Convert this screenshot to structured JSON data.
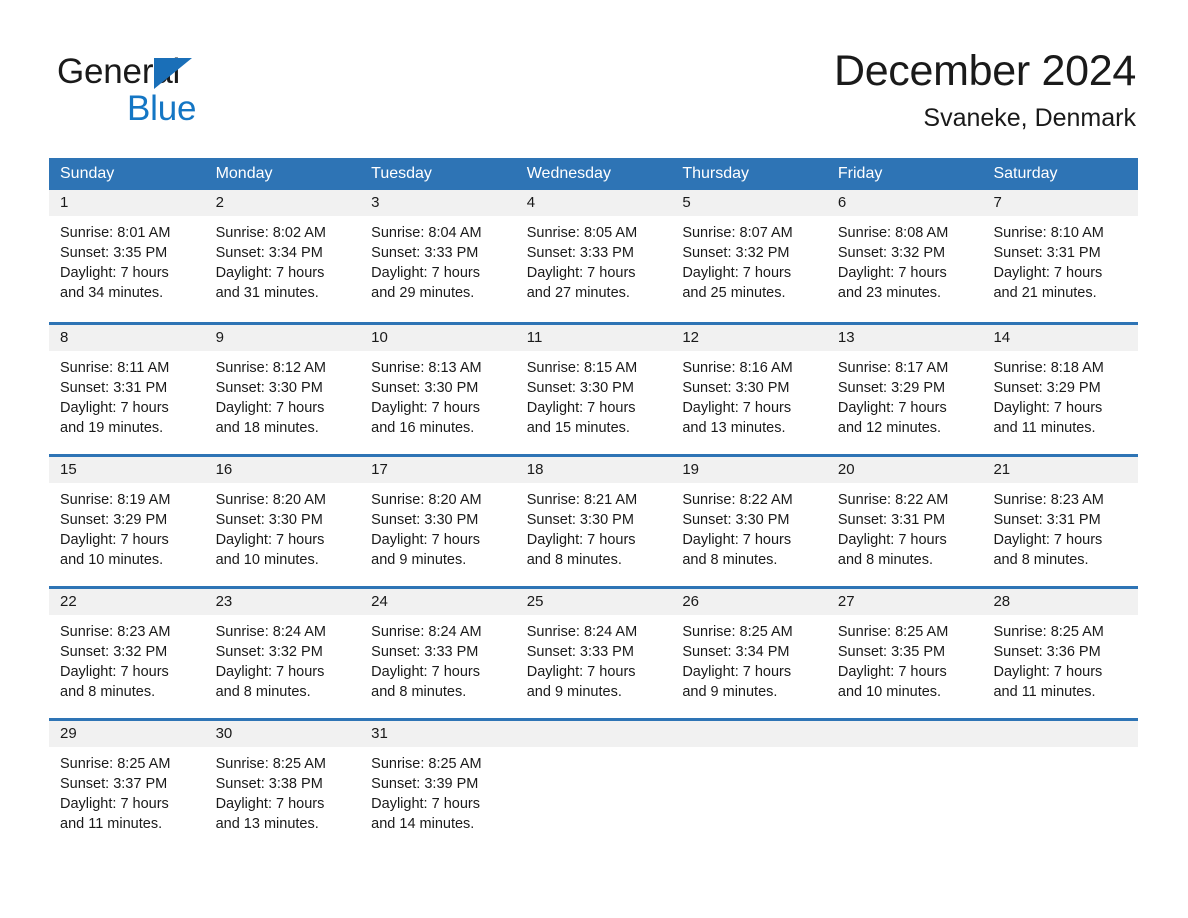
{
  "logo": {
    "word_general": "General",
    "word_blue": "Blue",
    "triangle_color": "#1a6fb8",
    "blue_color": "#1476c4"
  },
  "header": {
    "month_title": "December 2024",
    "location": "Svaneke, Denmark"
  },
  "theme": {
    "header_blue": "#2e74b5",
    "day_band_gray": "#f1f1f1",
    "text_color": "#1a1a1a",
    "page_background": "#ffffff"
  },
  "calendar": {
    "weekdays": [
      "Sunday",
      "Monday",
      "Tuesday",
      "Wednesday",
      "Thursday",
      "Friday",
      "Saturday"
    ],
    "weeks": [
      [
        {
          "day": "1",
          "sunrise": "Sunrise: 8:01 AM",
          "sunset": "Sunset: 3:35 PM",
          "daylight_line1": "Daylight: 7 hours",
          "daylight_line2": "and 34 minutes."
        },
        {
          "day": "2",
          "sunrise": "Sunrise: 8:02 AM",
          "sunset": "Sunset: 3:34 PM",
          "daylight_line1": "Daylight: 7 hours",
          "daylight_line2": "and 31 minutes."
        },
        {
          "day": "3",
          "sunrise": "Sunrise: 8:04 AM",
          "sunset": "Sunset: 3:33 PM",
          "daylight_line1": "Daylight: 7 hours",
          "daylight_line2": "and 29 minutes."
        },
        {
          "day": "4",
          "sunrise": "Sunrise: 8:05 AM",
          "sunset": "Sunset: 3:33 PM",
          "daylight_line1": "Daylight: 7 hours",
          "daylight_line2": "and 27 minutes."
        },
        {
          "day": "5",
          "sunrise": "Sunrise: 8:07 AM",
          "sunset": "Sunset: 3:32 PM",
          "daylight_line1": "Daylight: 7 hours",
          "daylight_line2": "and 25 minutes."
        },
        {
          "day": "6",
          "sunrise": "Sunrise: 8:08 AM",
          "sunset": "Sunset: 3:32 PM",
          "daylight_line1": "Daylight: 7 hours",
          "daylight_line2": "and 23 minutes."
        },
        {
          "day": "7",
          "sunrise": "Sunrise: 8:10 AM",
          "sunset": "Sunset: 3:31 PM",
          "daylight_line1": "Daylight: 7 hours",
          "daylight_line2": "and 21 minutes."
        }
      ],
      [
        {
          "day": "8",
          "sunrise": "Sunrise: 8:11 AM",
          "sunset": "Sunset: 3:31 PM",
          "daylight_line1": "Daylight: 7 hours",
          "daylight_line2": "and 19 minutes."
        },
        {
          "day": "9",
          "sunrise": "Sunrise: 8:12 AM",
          "sunset": "Sunset: 3:30 PM",
          "daylight_line1": "Daylight: 7 hours",
          "daylight_line2": "and 18 minutes."
        },
        {
          "day": "10",
          "sunrise": "Sunrise: 8:13 AM",
          "sunset": "Sunset: 3:30 PM",
          "daylight_line1": "Daylight: 7 hours",
          "daylight_line2": "and 16 minutes."
        },
        {
          "day": "11",
          "sunrise": "Sunrise: 8:15 AM",
          "sunset": "Sunset: 3:30 PM",
          "daylight_line1": "Daylight: 7 hours",
          "daylight_line2": "and 15 minutes."
        },
        {
          "day": "12",
          "sunrise": "Sunrise: 8:16 AM",
          "sunset": "Sunset: 3:30 PM",
          "daylight_line1": "Daylight: 7 hours",
          "daylight_line2": "and 13 minutes."
        },
        {
          "day": "13",
          "sunrise": "Sunrise: 8:17 AM",
          "sunset": "Sunset: 3:29 PM",
          "daylight_line1": "Daylight: 7 hours",
          "daylight_line2": "and 12 minutes."
        },
        {
          "day": "14",
          "sunrise": "Sunrise: 8:18 AM",
          "sunset": "Sunset: 3:29 PM",
          "daylight_line1": "Daylight: 7 hours",
          "daylight_line2": "and 11 minutes."
        }
      ],
      [
        {
          "day": "15",
          "sunrise": "Sunrise: 8:19 AM",
          "sunset": "Sunset: 3:29 PM",
          "daylight_line1": "Daylight: 7 hours",
          "daylight_line2": "and 10 minutes."
        },
        {
          "day": "16",
          "sunrise": "Sunrise: 8:20 AM",
          "sunset": "Sunset: 3:30 PM",
          "daylight_line1": "Daylight: 7 hours",
          "daylight_line2": "and 10 minutes."
        },
        {
          "day": "17",
          "sunrise": "Sunrise: 8:20 AM",
          "sunset": "Sunset: 3:30 PM",
          "daylight_line1": "Daylight: 7 hours",
          "daylight_line2": "and 9 minutes."
        },
        {
          "day": "18",
          "sunrise": "Sunrise: 8:21 AM",
          "sunset": "Sunset: 3:30 PM",
          "daylight_line1": "Daylight: 7 hours",
          "daylight_line2": "and 8 minutes."
        },
        {
          "day": "19",
          "sunrise": "Sunrise: 8:22 AM",
          "sunset": "Sunset: 3:30 PM",
          "daylight_line1": "Daylight: 7 hours",
          "daylight_line2": "and 8 minutes."
        },
        {
          "day": "20",
          "sunrise": "Sunrise: 8:22 AM",
          "sunset": "Sunset: 3:31 PM",
          "daylight_line1": "Daylight: 7 hours",
          "daylight_line2": "and 8 minutes."
        },
        {
          "day": "21",
          "sunrise": "Sunrise: 8:23 AM",
          "sunset": "Sunset: 3:31 PM",
          "daylight_line1": "Daylight: 7 hours",
          "daylight_line2": "and 8 minutes."
        }
      ],
      [
        {
          "day": "22",
          "sunrise": "Sunrise: 8:23 AM",
          "sunset": "Sunset: 3:32 PM",
          "daylight_line1": "Daylight: 7 hours",
          "daylight_line2": "and 8 minutes."
        },
        {
          "day": "23",
          "sunrise": "Sunrise: 8:24 AM",
          "sunset": "Sunset: 3:32 PM",
          "daylight_line1": "Daylight: 7 hours",
          "daylight_line2": "and 8 minutes."
        },
        {
          "day": "24",
          "sunrise": "Sunrise: 8:24 AM",
          "sunset": "Sunset: 3:33 PM",
          "daylight_line1": "Daylight: 7 hours",
          "daylight_line2": "and 8 minutes."
        },
        {
          "day": "25",
          "sunrise": "Sunrise: 8:24 AM",
          "sunset": "Sunset: 3:33 PM",
          "daylight_line1": "Daylight: 7 hours",
          "daylight_line2": "and 9 minutes."
        },
        {
          "day": "26",
          "sunrise": "Sunrise: 8:25 AM",
          "sunset": "Sunset: 3:34 PM",
          "daylight_line1": "Daylight: 7 hours",
          "daylight_line2": "and 9 minutes."
        },
        {
          "day": "27",
          "sunrise": "Sunrise: 8:25 AM",
          "sunset": "Sunset: 3:35 PM",
          "daylight_line1": "Daylight: 7 hours",
          "daylight_line2": "and 10 minutes."
        },
        {
          "day": "28",
          "sunrise": "Sunrise: 8:25 AM",
          "sunset": "Sunset: 3:36 PM",
          "daylight_line1": "Daylight: 7 hours",
          "daylight_line2": "and 11 minutes."
        }
      ],
      [
        {
          "day": "29",
          "sunrise": "Sunrise: 8:25 AM",
          "sunset": "Sunset: 3:37 PM",
          "daylight_line1": "Daylight: 7 hours",
          "daylight_line2": "and 11 minutes."
        },
        {
          "day": "30",
          "sunrise": "Sunrise: 8:25 AM",
          "sunset": "Sunset: 3:38 PM",
          "daylight_line1": "Daylight: 7 hours",
          "daylight_line2": "and 13 minutes."
        },
        {
          "day": "31",
          "sunrise": "Sunrise: 8:25 AM",
          "sunset": "Sunset: 3:39 PM",
          "daylight_line1": "Daylight: 7 hours",
          "daylight_line2": "and 14 minutes."
        },
        {
          "day": "",
          "sunrise": "",
          "sunset": "",
          "daylight_line1": "",
          "daylight_line2": ""
        },
        {
          "day": "",
          "sunrise": "",
          "sunset": "",
          "daylight_line1": "",
          "daylight_line2": ""
        },
        {
          "day": "",
          "sunrise": "",
          "sunset": "",
          "daylight_line1": "",
          "daylight_line2": ""
        },
        {
          "day": "",
          "sunrise": "",
          "sunset": "",
          "daylight_line1": "",
          "daylight_line2": ""
        }
      ]
    ]
  }
}
